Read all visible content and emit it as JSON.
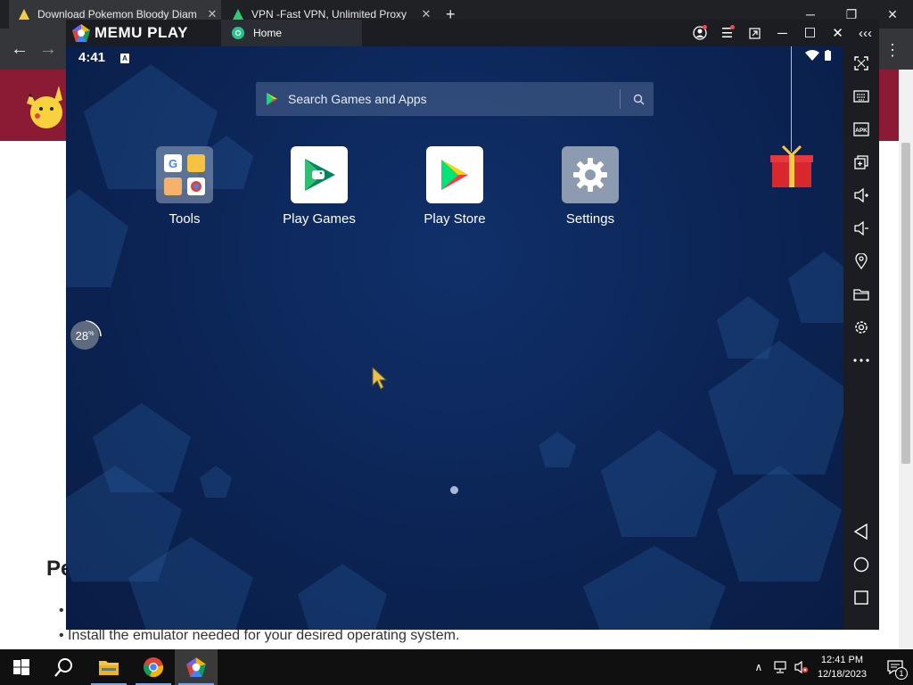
{
  "browser": {
    "tabs": [
      {
        "title": "Download Pokemon Bloody Diam",
        "active": true
      },
      {
        "title": "VPN -Fast VPN, Unlimited Proxy",
        "active": false
      }
    ],
    "new_tab_label": "+"
  },
  "webpage": {
    "heading": "Pe",
    "bullets": [
      "",
      "Install the emulator needed for your desired operating system."
    ]
  },
  "memu": {
    "brand": "MEMU PLAY",
    "home_tab": "Home",
    "status": {
      "time": "4:41",
      "badge": "A"
    },
    "search": {
      "placeholder": "Search Games and Apps"
    },
    "apps": [
      {
        "label": "Tools"
      },
      {
        "label": "Play Games"
      },
      {
        "label": "Play Store"
      },
      {
        "label": "Settings"
      }
    ],
    "progress": {
      "value": "28",
      "unit": "%"
    },
    "sidebar_icons": [
      "fullscreen-icon",
      "keyboard-icon",
      "apk-icon",
      "multi-window-icon",
      "volume-up-icon",
      "volume-down-icon",
      "location-icon",
      "folder-icon",
      "settings-icon",
      "more-icon",
      "back-icon",
      "home-icon",
      "recents-icon"
    ]
  },
  "taskbar": {
    "time": "12:41 PM",
    "date": "12/18/2023",
    "notification_count": "1"
  }
}
